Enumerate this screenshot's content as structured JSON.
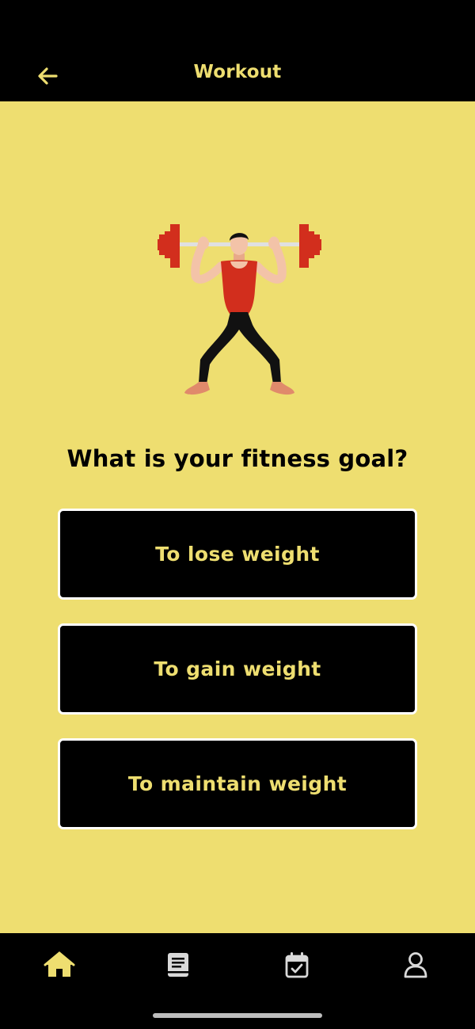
{
  "header": {
    "title": "Workout",
    "back_icon": "arrow-left-icon"
  },
  "main": {
    "question": "What is your fitness goal?",
    "options": [
      {
        "label": "To lose weight"
      },
      {
        "label": "To gain weight"
      },
      {
        "label": "To maintain weight"
      }
    ]
  },
  "tabbar": {
    "items": [
      {
        "icon": "home-icon",
        "active": true
      },
      {
        "icon": "book-icon",
        "active": false
      },
      {
        "icon": "calendar-check-icon",
        "active": false
      },
      {
        "icon": "user-icon",
        "active": false
      }
    ]
  },
  "colors": {
    "background": "#EEDE70",
    "accent": "#EEDE70",
    "bars": "#000000",
    "option_border": "#FFFFFF",
    "icon_inactive": "#D9D9D9"
  }
}
